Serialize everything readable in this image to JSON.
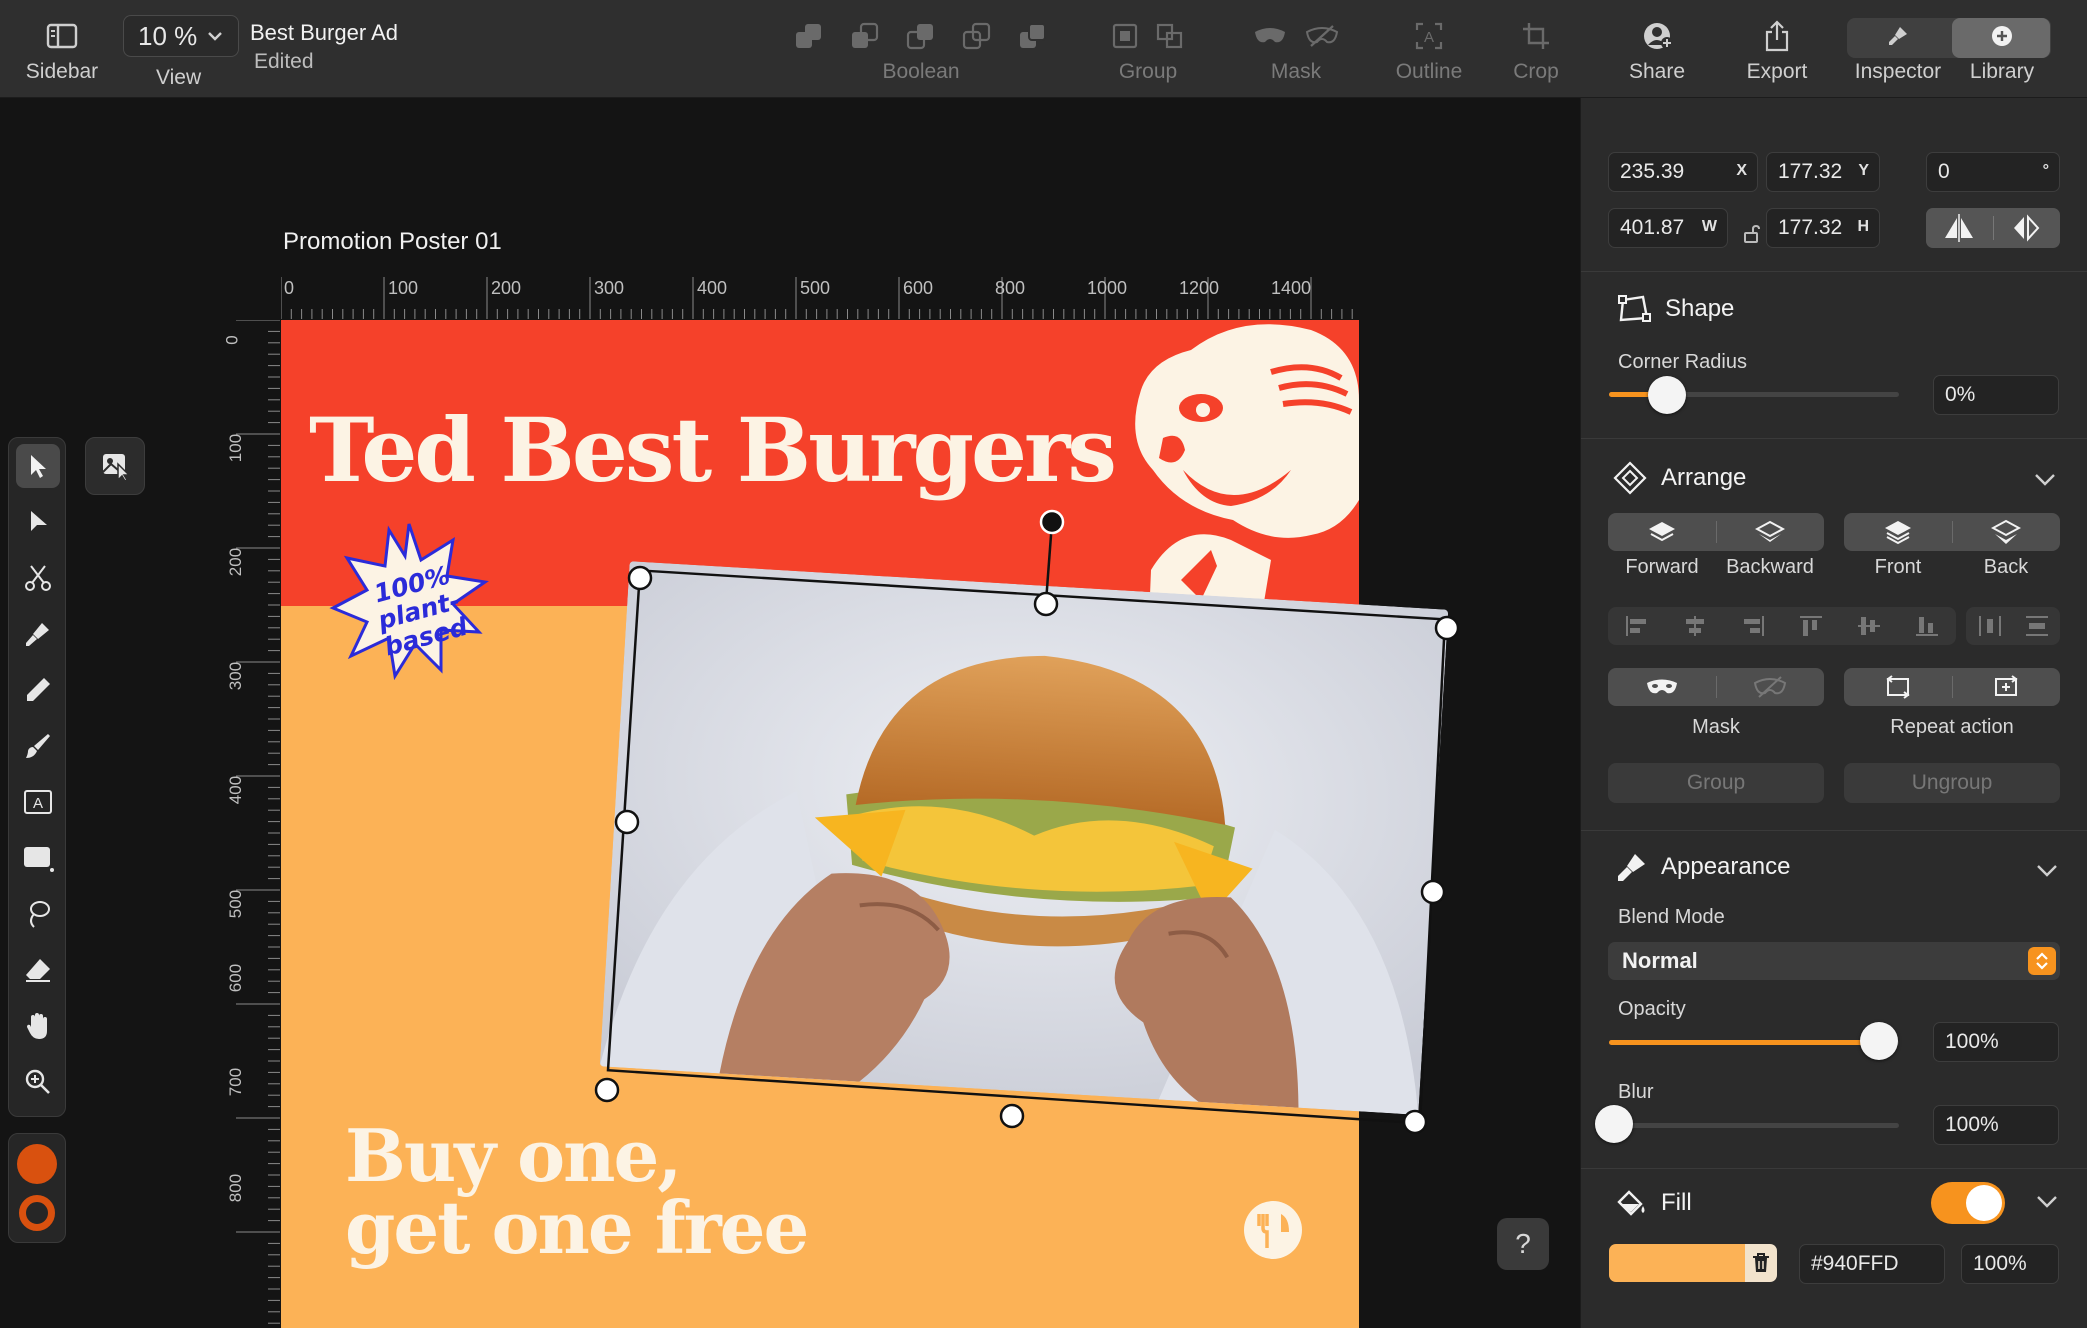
{
  "toolbar": {
    "sidebar_label": "Sidebar",
    "view_label": "View",
    "zoom_value": "10 %",
    "doc_title": "Best Burger Ad",
    "doc_status": "Edited",
    "boolean_label": "Boolean",
    "group_label": "Group",
    "mask_label": "Mask",
    "outline_label": "Outline",
    "crop_label": "Crop",
    "share_label": "Share",
    "export_label": "Export",
    "inspector_label": "Inspector",
    "library_label": "Library"
  },
  "canvas": {
    "artboard_title": "Promotion Poster 01",
    "ruler_h_labels": [
      "0",
      "100",
      "200",
      "300",
      "400",
      "500",
      "600",
      "800",
      "1000",
      "1200",
      "1400"
    ],
    "ruler_v_labels": [
      "0",
      "100",
      "200",
      "300",
      "400",
      "500",
      "600",
      "700",
      "800"
    ],
    "help_label": "?"
  },
  "poster": {
    "headline": "Ted Best Burgers",
    "badge_line1": "100%",
    "badge_line2": "plant-",
    "badge_line3": "based",
    "tagline_line1": "Buy one,",
    "tagline_line2": "get one free",
    "colors": {
      "red": "#f5412a",
      "orange": "#fcb256",
      "cream": "#fcf3e4",
      "badge_blue": "#2b2bd9"
    }
  },
  "inspector": {
    "x_value": "235.39",
    "x_label": "X",
    "y_value": "177.32",
    "y_label": "Y",
    "rotation_value": "0",
    "rotation_unit": "°",
    "w_value": "401.87",
    "w_label": "W",
    "h_value": "177.32",
    "h_label": "H",
    "shape": {
      "title": "Shape",
      "corner_radius_label": "Corner Radius",
      "corner_radius_value": "0%",
      "corner_radius_fraction": 0.2
    },
    "arrange": {
      "title": "Arrange",
      "forward": "Forward",
      "backward": "Backward",
      "front": "Front",
      "back": "Back",
      "mask": "Mask",
      "repeat_action": "Repeat action",
      "group": "Group",
      "ungroup": "Ungroup"
    },
    "appearance": {
      "title": "Appearance",
      "blend_mode_label": "Blend Mode",
      "blend_mode_value": "Normal",
      "opacity_label": "Opacity",
      "opacity_value": "100%",
      "opacity_fraction": 0.93,
      "blur_label": "Blur",
      "blur_value": "100%",
      "blur_fraction": 0.0
    },
    "fill": {
      "title": "Fill",
      "enabled": true,
      "hex": "#940FFD",
      "opacity": "100%",
      "swatch_color": "#fcb256"
    },
    "accent_color": "#f7931e"
  }
}
